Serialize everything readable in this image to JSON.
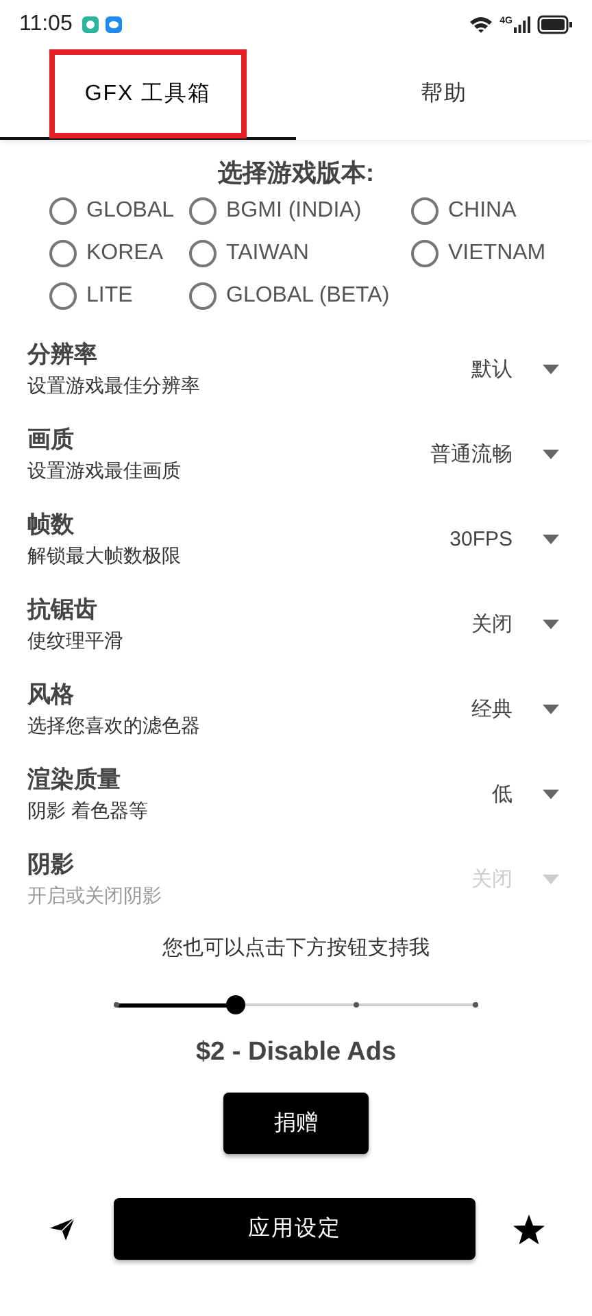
{
  "status_bar": {
    "time": "11:05",
    "network": "4G"
  },
  "tabs": [
    {
      "label": "GFX 工具箱",
      "selected": true,
      "highlighted": true
    },
    {
      "label": "帮助",
      "selected": false,
      "highlighted": false
    }
  ],
  "version_picker": {
    "title": "选择游戏版本:",
    "options": [
      {
        "label": "GLOBAL",
        "selected": false
      },
      {
        "label": "BGMI (INDIA)",
        "selected": false
      },
      {
        "label": "CHINA",
        "selected": false
      },
      {
        "label": "KOREA",
        "selected": false
      },
      {
        "label": "TAIWAN",
        "selected": false
      },
      {
        "label": "VIETNAM",
        "selected": false
      },
      {
        "label": "LITE",
        "selected": false
      },
      {
        "label": "GLOBAL (BETA)",
        "selected": false
      }
    ]
  },
  "settings": [
    {
      "title": "分辨率",
      "subtitle": "设置游戏最佳分辨率",
      "value": "默认",
      "disabled": false
    },
    {
      "title": "画质",
      "subtitle": "设置游戏最佳画质",
      "value": "普通流畅",
      "disabled": false
    },
    {
      "title": "帧数",
      "subtitle": "解锁最大帧数极限",
      "value": "30FPS",
      "disabled": false
    },
    {
      "title": "抗锯齿",
      "subtitle": "使纹理平滑",
      "value": "关闭",
      "disabled": false
    },
    {
      "title": "风格",
      "subtitle": "选择您喜欢的滤色器",
      "value": "经典",
      "disabled": false
    },
    {
      "title": "渲染质量",
      "subtitle": "阴影 着色器等",
      "value": "低",
      "disabled": false
    },
    {
      "title": "阴影",
      "subtitle": "开启或关闭阴影",
      "value": "关闭",
      "disabled": true
    }
  ],
  "support": {
    "message": "您也可以点击下方按钮支持我",
    "slider": {
      "level": 0.3333
    },
    "price_label": "$2 - Disable Ads",
    "donate_button": "捐赠"
  },
  "bottom_bar": {
    "apply_button": "应用设定"
  }
}
